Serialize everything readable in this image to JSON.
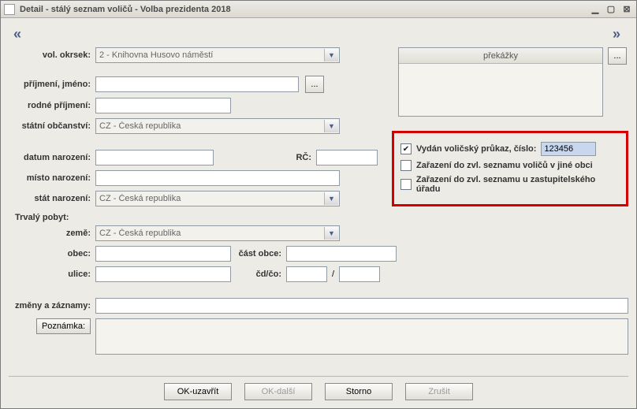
{
  "window": {
    "title": "Detail - stálý seznam voličů - Volba prezidenta 2018"
  },
  "nav": {
    "prev": "«",
    "next": "»"
  },
  "labels": {
    "vol_okrsek": "vol. okrsek:",
    "prijmeni_jmeno": "příjmení, jméno:",
    "rodne_prijmeni": "rodné příjmení:",
    "statni_obcanstvi": "státní občanství:",
    "datum_narozeni": "datum narození:",
    "rc": "RČ:",
    "misto_narozeni": "místo narození:",
    "stat_narozeni": "stát narození:",
    "trvaly_pobyt": "Trvalý pobyt:",
    "zeme": "země:",
    "obec": "obec:",
    "cast_obce": "část obce:",
    "ulice": "ulice:",
    "cd_co": "čd/čo:",
    "zmeny": "změny a záznamy:",
    "poznamka": "Poznámka:",
    "slash": "/"
  },
  "values": {
    "vol_okrsek": "2 - Knihovna Husovo náměstí",
    "prijmeni_jmeno": "",
    "rodne_prijmeni": "",
    "statni_obcanstvi": "CZ - Česká republika",
    "datum_narozeni": "",
    "rc": "",
    "misto_narozeni": "",
    "stat_narozeni": "CZ - Česká republika",
    "zeme": "CZ - Česká republika",
    "obec": "",
    "cast_obce": "",
    "ulice": "",
    "cd": "",
    "co": "",
    "zmeny": "",
    "poznamka": ""
  },
  "overlay": {
    "prekazky_header": "překážky",
    "ellipsis": "..."
  },
  "checkboxes": {
    "vydan_prukaz": {
      "label": "Vydán voličský průkaz,  číslo:",
      "checked": true,
      "cislo": "123456"
    },
    "zarazeni_jina_obec": {
      "label": "Zařazení do zvl. seznamu voličů v jiné obci",
      "checked": false
    },
    "zarazeni_zastup": {
      "label": "Zařazení do zvl. seznamu u zastupitelského úřadu",
      "checked": false
    }
  },
  "buttons": {
    "ok_uzavrit": "OK-uzavřít",
    "ok_dalsi": "OK-další",
    "storno": "Storno",
    "zrusit": "Zrušit",
    "ellipsis": "..."
  }
}
